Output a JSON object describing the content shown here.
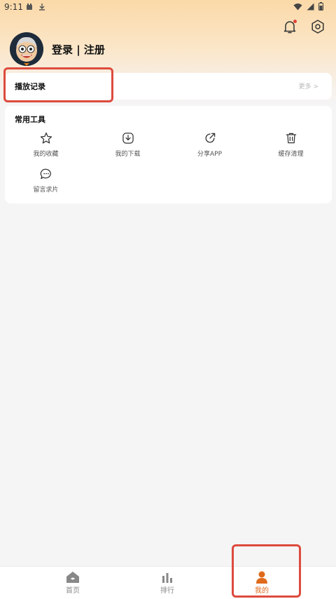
{
  "status_bar": {
    "time": "9:11"
  },
  "header": {
    "login_label": "登录 | 注册"
  },
  "history": {
    "title": "播放记录",
    "more_label": "更多 >"
  },
  "tools": {
    "title": "常用工具",
    "items": [
      {
        "label": "我的收藏",
        "icon": "star-icon"
      },
      {
        "label": "我的下载",
        "icon": "download-icon"
      },
      {
        "label": "分享APP",
        "icon": "share-icon"
      },
      {
        "label": "缓存清理",
        "icon": "trash-icon"
      },
      {
        "label": "留言求片",
        "icon": "message-icon"
      }
    ]
  },
  "bottom_nav": {
    "items": [
      {
        "label": "首页",
        "icon": "home-icon",
        "active": false
      },
      {
        "label": "排行",
        "icon": "chart-icon",
        "active": false
      },
      {
        "label": "我的",
        "icon": "person-icon",
        "active": true
      }
    ]
  },
  "colors": {
    "accent": "#e06a1c",
    "highlight": "#dd4b3e",
    "header_gradient": "#fbd9a8"
  }
}
